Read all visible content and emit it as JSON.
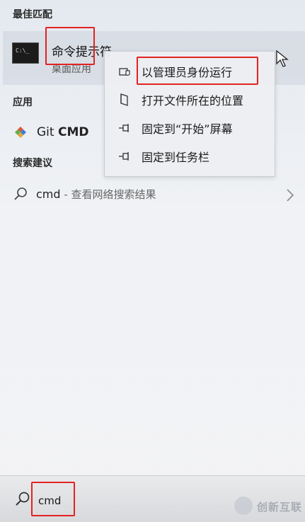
{
  "sections": {
    "best_match": "最佳匹配",
    "apps": "应用",
    "search_suggestions": "搜索建议"
  },
  "best_match_item": {
    "icon_text": "C:\\_",
    "name": "命令提示符",
    "subtitle": "桌面应用"
  },
  "context_menu": {
    "items": [
      {
        "label": "以管理员身份运行",
        "icon": "shield-icon"
      },
      {
        "label": "打开文件所在的位置",
        "icon": "folder-icon"
      },
      {
        "label": "固定到“开始”屏幕",
        "icon": "pin-icon"
      },
      {
        "label": "固定到任务栏",
        "icon": "pin-icon"
      }
    ]
  },
  "apps": {
    "git_cmd": {
      "prefix": "Git ",
      "bold": "CMD",
      "icon": "git-diamond-icon"
    }
  },
  "suggestion": {
    "query": "cmd",
    "rest": " - 查看网络搜索结果",
    "icon": "search-icon"
  },
  "search_box": {
    "value": "cmd"
  },
  "watermark": {
    "text": "创新互联"
  },
  "colors": {
    "highlight_box": "#e32222",
    "git_orange": "#e0563b",
    "git_blue": "#3b7dd8"
  }
}
